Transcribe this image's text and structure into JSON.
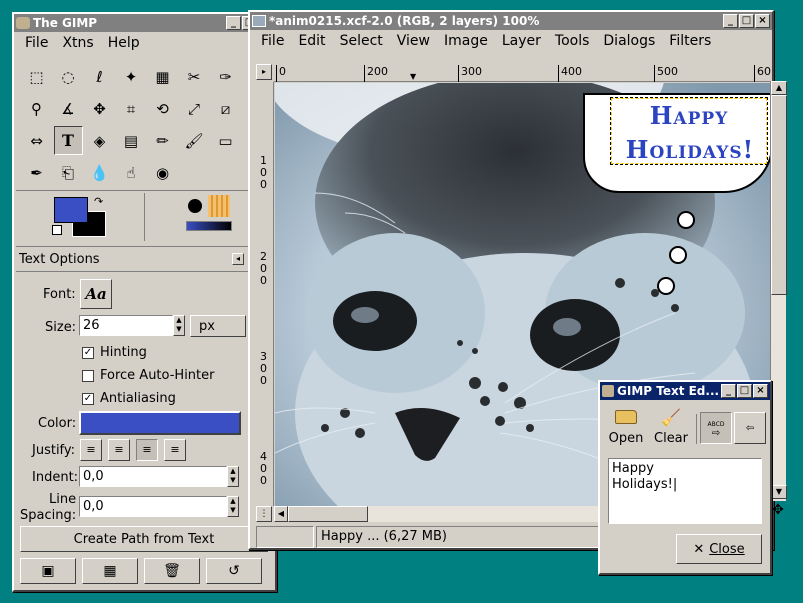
{
  "toolbox": {
    "title": "The GIMP",
    "menu": [
      "File",
      "Xtns",
      "Help"
    ],
    "tools": [
      "rect-select-icon",
      "ellipse-select-icon",
      "lasso-icon",
      "magic-wand-icon",
      "color-select-icon",
      "scissors-icon",
      "paths-icon",
      "color-picker-icon",
      "magnify-icon",
      "measure-icon",
      "move-icon",
      "crop-icon",
      "rotate-icon",
      "scale-icon",
      "shear-icon",
      "perspective-icon",
      "flip-icon",
      "text-icon",
      "bucket-fill-icon",
      "blend-icon",
      "pencil-icon",
      "paintbrush-icon",
      "eraser-icon",
      "airbrush-icon",
      "ink-icon",
      "clone-icon",
      "blur-icon",
      "smudge-icon",
      "dodge-burn-icon"
    ],
    "fg_color": "#3a4fc4",
    "bg_color": "#000000"
  },
  "text_options": {
    "header": "Text Options",
    "font_label": "Font:",
    "font_preview": "Aa",
    "size_label": "Size:",
    "size_value": "26",
    "size_unit": "px",
    "hinting": "Hinting",
    "force_autohinter": "Force Auto-Hinter",
    "antialiasing": "Antialiasing",
    "color_label": "Color:",
    "justify_label": "Justify:",
    "indent_label": "Indent:",
    "indent_value": "0,0",
    "line_spacing_label_1": "Line",
    "line_spacing_label_2": "Spacing:",
    "line_spacing_value": "0,0",
    "create_path": "Create Path from Text"
  },
  "image_window": {
    "title": "*anim0215.xcf-2.0 (RGB, 2 layers) 100%",
    "menu": [
      "File",
      "Edit",
      "Select",
      "View",
      "Image",
      "Layer",
      "Tools",
      "Dialogs",
      "Filters"
    ],
    "ruler_top": [
      "0",
      "200",
      "300",
      "400",
      "500",
      "60"
    ],
    "ruler_left": [
      "1",
      "0",
      "0",
      "2",
      "0",
      "0",
      "3",
      "0",
      "0",
      "4",
      "0",
      "0"
    ],
    "bubble_line1": "Happy",
    "bubble_line2": "Holidays!",
    "status": "Happy  ... (6,27 MB)"
  },
  "text_editor": {
    "title": "GIMP Text Ed...",
    "open": "Open",
    "clear": "Clear",
    "ltr_label": "ABCD",
    "content_line1": "Happy",
    "content_line2": "Holidays!",
    "close": "Close"
  }
}
